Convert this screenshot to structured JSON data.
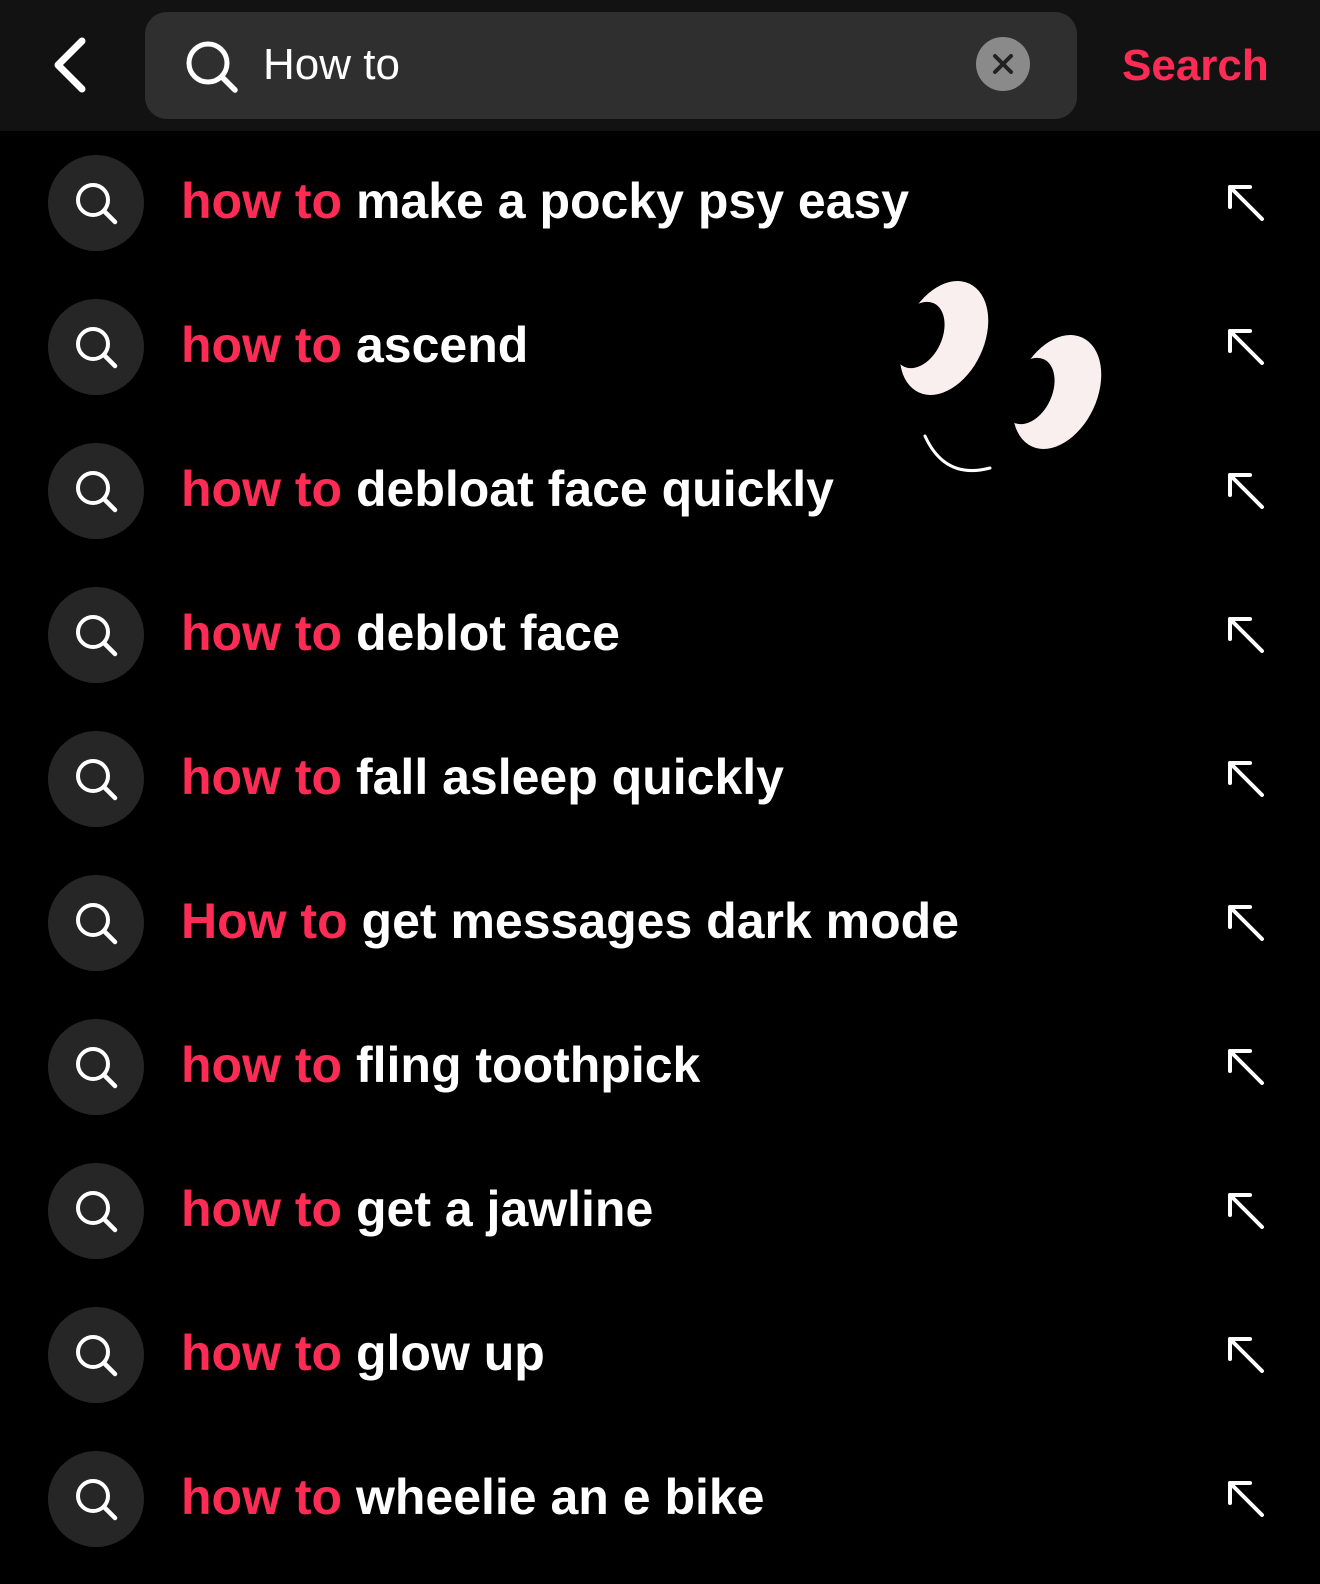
{
  "colors": {
    "accent": "#fe2c55",
    "background": "#000000",
    "topbar": "#121212",
    "search_field": "#2f2f2f",
    "text": "#ffffff"
  },
  "header": {
    "back_icon": "chevron-left-icon",
    "search_icon": "search-icon",
    "query": "How to",
    "clear_icon": "clear-x-icon",
    "search_label": "Search"
  },
  "suggestions": [
    {
      "highlight": "how to",
      "rest": "make a pocky psy easy"
    },
    {
      "highlight": "how to",
      "rest": "ascend"
    },
    {
      "highlight": "how to",
      "rest": "debloat face quickly"
    },
    {
      "highlight": "how to",
      "rest": "deblot face"
    },
    {
      "highlight": "how to",
      "rest": "fall asleep quickly"
    },
    {
      "highlight": "How to",
      "rest": "get messages dark mode"
    },
    {
      "highlight": "how to",
      "rest": "fling toothpick"
    },
    {
      "highlight": "how to",
      "rest": "get a jawline"
    },
    {
      "highlight": "how to",
      "rest": "glow up"
    },
    {
      "highlight": "how to",
      "rest": "wheelie an e bike"
    }
  ],
  "suggestion_icons": {
    "leading": "search-icon",
    "trailing": "arrow-up-left-icon"
  },
  "sticker": {
    "type": "googly-eyes-sticker"
  }
}
